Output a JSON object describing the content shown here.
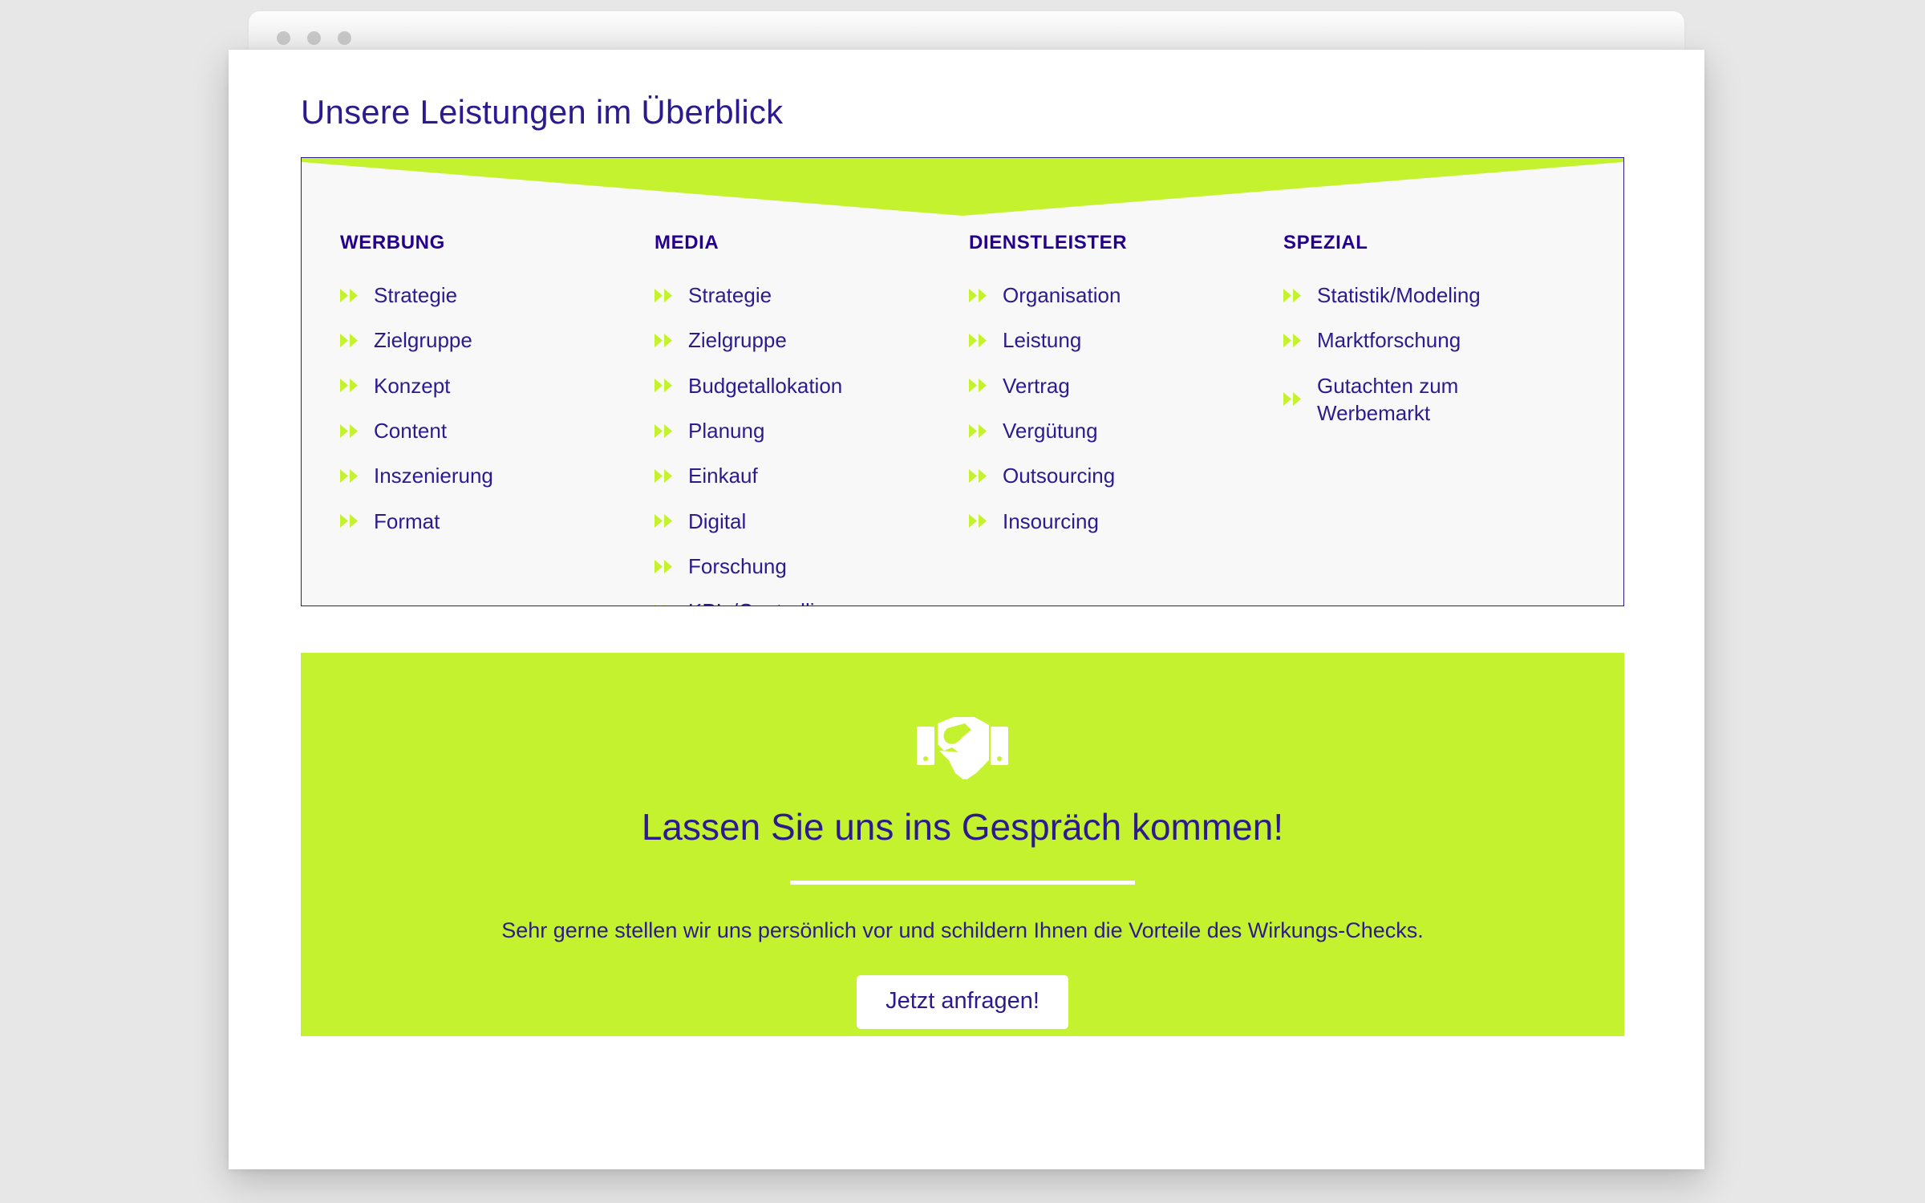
{
  "browser": {
    "dots": [
      "window-dot-1",
      "window-dot-2",
      "window-dot-3"
    ]
  },
  "page": {
    "title": "Unsere Leistungen im Überblick"
  },
  "colors": {
    "accent_green": "#C4F22E",
    "navy": "#2B1B8E",
    "heading_navy": "#25008C",
    "card_bg": "#F8F8F8",
    "page_bg": "#E7E7E7",
    "white": "#FFFFFF"
  },
  "services": {
    "bullet_icon": "double-chevron-right-icon",
    "columns": [
      {
        "title": "WERBUNG",
        "items": [
          "Strategie",
          "Zielgruppe",
          "Konzept",
          "Content",
          "Inszenierung",
          "Format"
        ]
      },
      {
        "title": "MEDIA",
        "items": [
          "Strategie",
          "Zielgruppe",
          "Budgetallokation",
          "Planung",
          "Einkauf",
          "Digital",
          "Forschung",
          "KPIs/Controlling"
        ]
      },
      {
        "title": "DIENSTLEISTER",
        "items": [
          "Organisation",
          "Leistung",
          "Vertrag",
          "Vergütung",
          "Outsourcing",
          "Insourcing"
        ]
      },
      {
        "title": "SPEZIAL",
        "items": [
          "Statistik/Modeling",
          "Marktforschung",
          "Gutachten zum Werbemarkt"
        ]
      }
    ]
  },
  "cta": {
    "icon": "handshake-icon",
    "heading": "Lassen Sie uns ins Gespräch kommen!",
    "text": "Sehr gerne stellen wir uns persönlich vor und schildern Ihnen die Vorteile des Wirkungs-Checks.",
    "button_label": "Jetzt anfragen!"
  }
}
